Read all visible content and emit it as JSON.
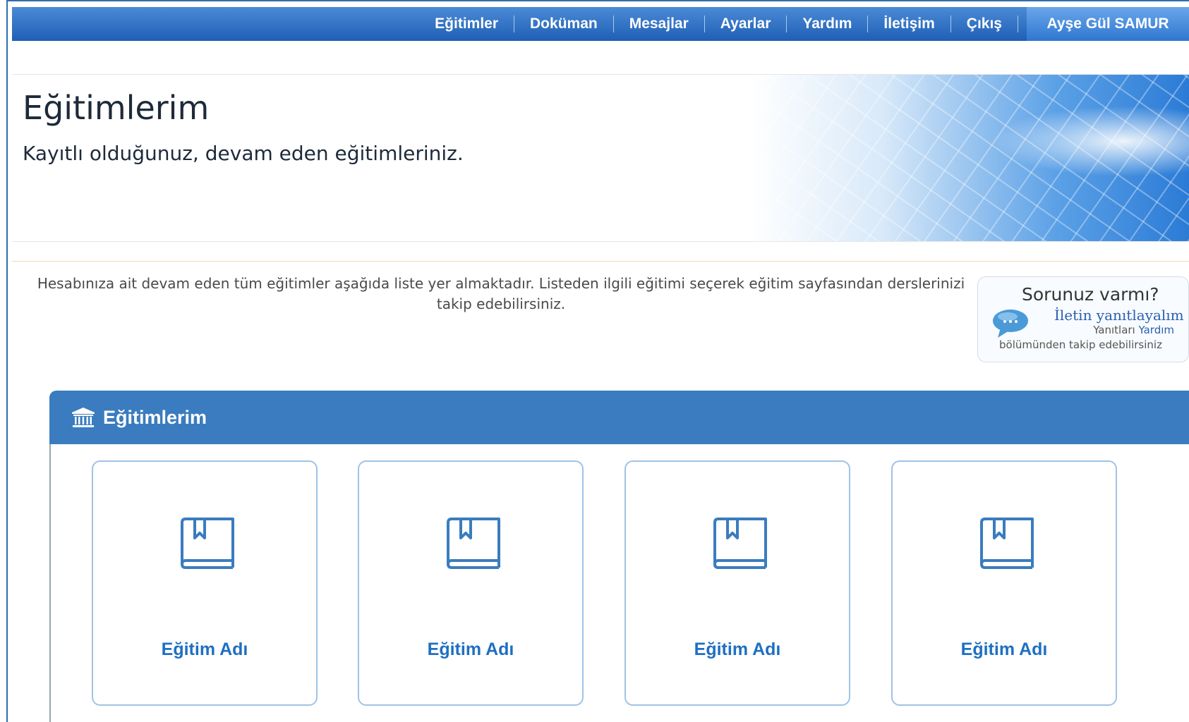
{
  "nav": {
    "items": [
      "Eğitimler",
      "Doküman",
      "Mesajlar",
      "Ayarlar",
      "Yardım",
      "İletişim",
      "Çıkış"
    ],
    "user_name": "Ayşe Gül SAMUR"
  },
  "hero": {
    "title": "Eğitimlerim",
    "subtitle": "Kayıtlı olduğunuz, devam eden eğitimleriniz."
  },
  "intro": "Hesabınıza ait devam eden tüm eğitimler aşağıda liste yer almaktadır. Listeden ilgili eğitimi seçerek eğitim sayfasından derslerinizi takip edebilirsiniz.",
  "help": {
    "question": "Sorunuz varmı?",
    "link": "İletin yanıtlayalım",
    "line1_prefix": "Yanıtları ",
    "line1_link": "Yardım",
    "line2": "bölümünden takip edebilirsiniz"
  },
  "panel": {
    "title": "Eğitimlerim",
    "icon": "institution-icon"
  },
  "courses": [
    {
      "name": "Eğitim Adı",
      "icon": "book-icon"
    },
    {
      "name": "Eğitim Adı",
      "icon": "book-icon"
    },
    {
      "name": "Eğitim Adı",
      "icon": "book-icon"
    },
    {
      "name": "Eğitim Adı",
      "icon": "book-icon"
    }
  ],
  "colors": {
    "nav_blue": "#1f5fb5",
    "panel_blue": "#3a7cbf",
    "link_blue": "#1f6fc2"
  }
}
